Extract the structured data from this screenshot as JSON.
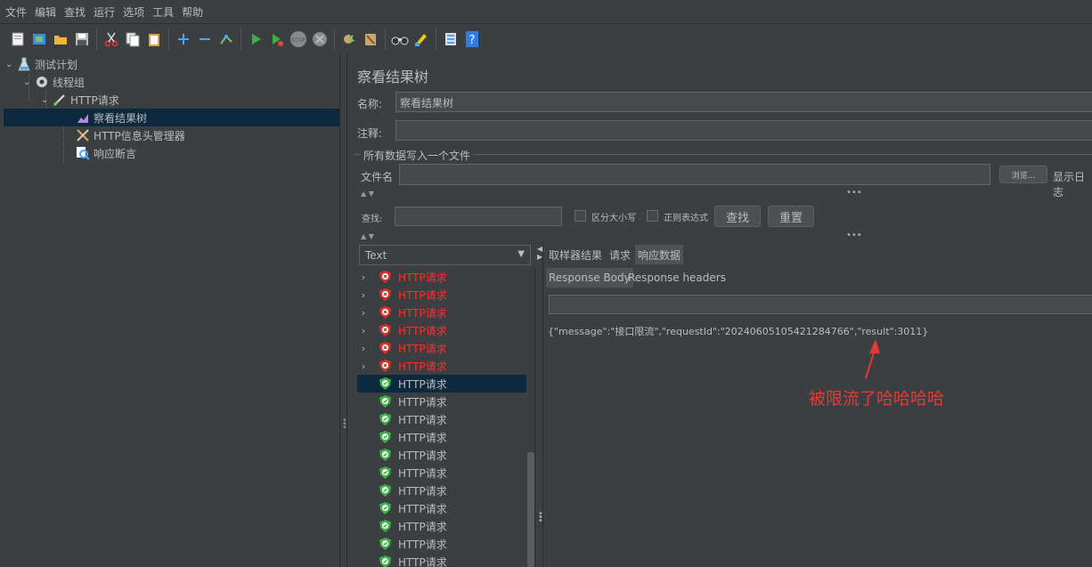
{
  "menu": [
    "文件",
    "编辑",
    "查找",
    "运行",
    "选项",
    "工具",
    "帮助"
  ],
  "toolbar_icons": [
    "new-icon",
    "templates-icon",
    "open-icon",
    "save-icon",
    "cut-icon",
    "copy-icon",
    "paste-icon",
    "expand-icon",
    "collapse-icon",
    "toggle-icon",
    "start-icon",
    "start-no-pause-icon",
    "stop-icon",
    "shutdown-icon",
    "clear-icon",
    "clear-all-icon",
    "search-icon",
    "reset-search-icon",
    "function-helper-icon",
    "help-icon"
  ],
  "tree": {
    "test_plan": "测试计划",
    "thread_group": "线程组",
    "http_request": "HTTP请求",
    "view_results_tree": "察看结果树",
    "header_manager": "HTTP信息头管理器",
    "response_assertion": "响应断言"
  },
  "panel": {
    "title": "察看结果树",
    "name_label": "名称:",
    "name_value": "察看结果树",
    "comment_label": "注释:",
    "comment_value": "",
    "write_all_label": "所有数据写入一个文件",
    "filename_label": "文件名",
    "filename_value": "",
    "browse_button": "浏览...",
    "log_label": "显示日志",
    "search_label": "查找:",
    "search_value": "",
    "case_sensitive": "区分大小写",
    "regex": "正则表达式",
    "search_button": "查找",
    "reset_button": "重置"
  },
  "renderer": {
    "selected": "Text",
    "options": [
      "Text"
    ]
  },
  "results": [
    {
      "label": "HTTP请求",
      "status": "error"
    },
    {
      "label": "HTTP请求",
      "status": "error"
    },
    {
      "label": "HTTP请求",
      "status": "error"
    },
    {
      "label": "HTTP请求",
      "status": "error"
    },
    {
      "label": "HTTP请求",
      "status": "error"
    },
    {
      "label": "HTTP请求",
      "status": "error"
    },
    {
      "label": "HTTP请求",
      "status": "ok",
      "selected": true
    },
    {
      "label": "HTTP请求",
      "status": "ok"
    },
    {
      "label": "HTTP请求",
      "status": "ok"
    },
    {
      "label": "HTTP请求",
      "status": "ok"
    },
    {
      "label": "HTTP请求",
      "status": "ok"
    },
    {
      "label": "HTTP请求",
      "status": "ok"
    },
    {
      "label": "HTTP请求",
      "status": "ok"
    },
    {
      "label": "HTTP请求",
      "status": "ok"
    },
    {
      "label": "HTTP请求",
      "status": "ok"
    },
    {
      "label": "HTTP请求",
      "status": "ok"
    },
    {
      "label": "HTTP请求",
      "status": "ok"
    }
  ],
  "tabs": {
    "sampler_result": "取样器结果",
    "request": "请求",
    "response_data": "响应数据",
    "response_body": "Response Body",
    "response_headers": "Response headers"
  },
  "response_text": "{\"message\":\"接口限流\",\"requestId\":\"20240605105421284766\",\"result\":3011}",
  "annotation": "被限流了哈哈哈哈",
  "colors": {
    "error": "#ff2b2b",
    "annotation": "#e53935",
    "selection": "#0d293e"
  }
}
